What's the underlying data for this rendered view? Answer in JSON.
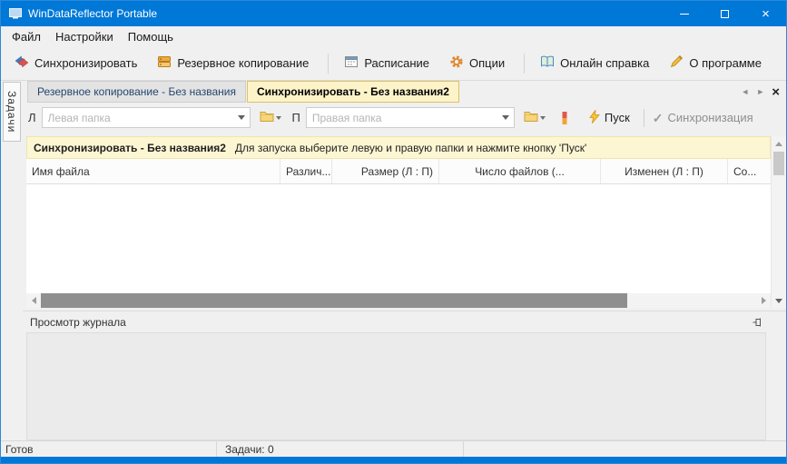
{
  "window": {
    "title": "WinDataReflector Portable"
  },
  "icons": {
    "close": "×",
    "tab_prev": "◄",
    "tab_next": "►",
    "check": "✓"
  },
  "menu": {
    "items": [
      {
        "label": "Файл"
      },
      {
        "label": "Настройки"
      },
      {
        "label": "Помощь"
      }
    ]
  },
  "toolbar": {
    "buttons": [
      {
        "label": "Синхронизировать",
        "icon": "sync-arrows-icon"
      },
      {
        "label": "Резервное копирование",
        "icon": "backup-icon"
      },
      {
        "label": "Расписание",
        "icon": "schedule-calendar-icon"
      },
      {
        "label": "Опции",
        "icon": "gear-icon"
      },
      {
        "label": "Онлайн справка",
        "icon": "help-book-icon"
      },
      {
        "label": "О программе",
        "icon": "about-pencil-icon"
      }
    ]
  },
  "side_tab": {
    "label": "Задачи"
  },
  "tabs": {
    "items": [
      {
        "label": "Резервное копирование - Без названия",
        "active": false
      },
      {
        "label": "Синхронизировать - Без названия2",
        "active": true
      }
    ]
  },
  "folder_bar": {
    "left_label": "Л",
    "left_placeholder": "Левая папка",
    "right_label": "П",
    "right_placeholder": "Правая папка",
    "start_button": "Пуск",
    "mode_label": "Синхронизация"
  },
  "info_bar": {
    "task_name": "Синхронизировать - Без названия2",
    "message": "Для запуска выберите левую и правую папки и нажмите кнопку 'Пуск'"
  },
  "file_table": {
    "columns": [
      "Имя файла",
      "Различ...",
      "Размер (Л : П)",
      "Число файлов (...",
      "Изменен (Л : П)",
      "Со..."
    ],
    "rows": []
  },
  "journal": {
    "title": "Просмотр журнала"
  },
  "status_bar": {
    "ready": "Готов",
    "tasks": "Задачи: 0"
  },
  "colors": {
    "titlebar": "#0078d7",
    "active_tab": "#fdf3c9",
    "info_bar": "#fcf6d3",
    "accent_orange": "#e8962e"
  }
}
